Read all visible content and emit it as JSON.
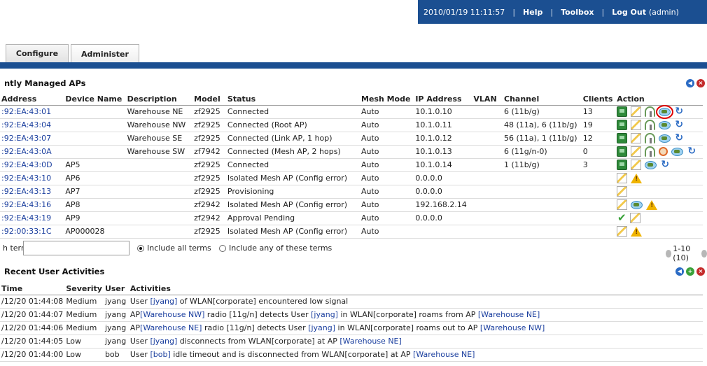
{
  "topbar": {
    "datetime": "2010/01/19  11:11:57",
    "help": "Help",
    "toolbox": "Toolbox",
    "logout": "Log Out",
    "user": "(admin)"
  },
  "tabs": {
    "configure": "Configure",
    "administer": "Administer"
  },
  "ap_panel": {
    "title": "ntly Managed APs",
    "columns": [
      "Address",
      "Device Name",
      "Description",
      "Model",
      "Status",
      "Mesh Mode",
      "IP Address",
      "VLAN",
      "Channel",
      "Clients",
      "Action"
    ],
    "rows": [
      {
        "mac": ":92:EA:43:01",
        "name": "",
        "desc": "Warehouse NE",
        "model": "zf2925",
        "status": "Connected",
        "mesh": "Auto",
        "ip": "10.1.0.10",
        "vlan": "",
        "channel": "6 (11b/g)",
        "clients": "13",
        "actions": [
          "monitor-icon",
          "edit-icon",
          "antenna-icon",
          "speedflex-icon",
          "restart-icon"
        ]
      },
      {
        "mac": ":92:EA:43:04",
        "name": "",
        "desc": "Warehouse NW",
        "model": "zf2925",
        "status": "Connected (Root AP)",
        "mesh": "Auto",
        "ip": "10.1.0.11",
        "vlan": "",
        "channel": "48 (11a), 6 (11b/g)",
        "clients": "19",
        "actions": [
          "monitor-icon",
          "edit-icon",
          "antenna-icon",
          "speedflex-icon",
          "restart-icon"
        ]
      },
      {
        "mac": ":92:EA:43:07",
        "name": "",
        "desc": "Warehouse SE",
        "model": "zf2925",
        "status": "Connected (Link AP, 1 hop)",
        "mesh": "Auto",
        "ip": "10.1.0.12",
        "vlan": "",
        "channel": "56 (11a), 1 (11b/g)",
        "clients": "12",
        "actions": [
          "monitor-icon",
          "edit-icon",
          "antenna-icon",
          "speedflex-icon",
          "restart-icon"
        ]
      },
      {
        "mac": ":92:EA:43:0A",
        "name": "",
        "desc": "Warehouse SW",
        "model": "zf7942",
        "status": "Connected (Mesh AP, 2 hops)",
        "mesh": "Auto",
        "ip": "10.1.0.13",
        "vlan": "",
        "channel": "6 (11g/n-0)",
        "clients": "0",
        "actions": [
          "monitor-icon",
          "edit-icon",
          "antenna-icon",
          "block-icon",
          "speedflex-icon",
          "restart-icon"
        ]
      },
      {
        "mac": ":92:EA:43:0D",
        "name": "AP5",
        "desc": "",
        "model": "zf2925",
        "status": "Connected",
        "mesh": "Auto",
        "ip": "10.1.0.14",
        "vlan": "",
        "channel": "1 (11b/g)",
        "clients": "3",
        "actions": [
          "monitor-icon",
          "edit-icon",
          "speedflex-icon",
          "restart-icon"
        ]
      },
      {
        "mac": ":92:EA:43:10",
        "name": "AP6",
        "desc": "",
        "model": "zf2925",
        "status": "Isolated Mesh AP (Config error)",
        "mesh": "Auto",
        "ip": "0.0.0.0",
        "vlan": "",
        "channel": "",
        "clients": "",
        "actions": [
          "edit-icon",
          "warning-icon"
        ]
      },
      {
        "mac": ":92:EA:43:13",
        "name": "AP7",
        "desc": "",
        "model": "zf2925",
        "status": "Provisioning",
        "mesh": "Auto",
        "ip": "0.0.0.0",
        "vlan": "",
        "channel": "",
        "clients": "",
        "actions": [
          "edit-icon"
        ]
      },
      {
        "mac": ":92:EA:43:16",
        "name": "AP8",
        "desc": "",
        "model": "zf2942",
        "status": "Isolated Mesh AP (Config error)",
        "mesh": "Auto",
        "ip": "192.168.2.14",
        "vlan": "",
        "channel": "",
        "clients": "",
        "actions": [
          "edit-icon",
          "speedflex-icon",
          "warning-icon"
        ]
      },
      {
        "mac": ":92:EA:43:19",
        "name": "AP9",
        "desc": "",
        "model": "zf2942",
        "status": "Approval Pending",
        "mesh": "Auto",
        "ip": "0.0.0.0",
        "vlan": "",
        "channel": "",
        "clients": "",
        "actions": [
          "approve-icon",
          "edit-icon"
        ]
      },
      {
        "mac": ":92:00:33:1C",
        "name": "AP000028",
        "desc": "",
        "model": "zf2925",
        "status": "Isolated Mesh AP (Config error)",
        "mesh": "Auto",
        "ip": "",
        "vlan": "",
        "channel": "",
        "clients": "",
        "actions": [
          "edit-icon",
          "warning-icon"
        ]
      }
    ],
    "search_label": "h terms",
    "search_value": "",
    "radio_all": "Include all terms",
    "radio_any": "Include any of these terms",
    "pager": "1-10 (10)"
  },
  "activity_panel": {
    "title": "Recent User Activities",
    "columns": [
      "Time",
      "Severity",
      "User",
      "Activities"
    ],
    "rows": [
      {
        "time": "/12/20 01:44:08",
        "severity": "Medium",
        "user": "jyang",
        "parts": [
          {
            "t": "User "
          },
          {
            "l": "[jyang]"
          },
          {
            "t": " of WLAN[corporate] encountered low signal"
          }
        ]
      },
      {
        "time": "/12/20 01:44:07",
        "severity": "Medium",
        "user": "jyang",
        "parts": [
          {
            "t": "AP"
          },
          {
            "l": "[Warehouse NW]"
          },
          {
            "t": " radio [11g/n] detects User "
          },
          {
            "l": "[jyang]"
          },
          {
            "t": " in WLAN[corporate] roams from AP "
          },
          {
            "l": "[Warehouse NE]"
          }
        ]
      },
      {
        "time": "/12/20 01:44:06",
        "severity": "Medium",
        "user": "jyang",
        "parts": [
          {
            "t": "AP"
          },
          {
            "l": "[Warehouse NE]"
          },
          {
            "t": " radio [11g/n] detects User "
          },
          {
            "l": "[jyang]"
          },
          {
            "t": " in WLAN[corporate] roams out to AP "
          },
          {
            "l": "[Warehouse NW]"
          }
        ]
      },
      {
        "time": "/12/20 01:44:05",
        "severity": "Low",
        "user": "jyang",
        "parts": [
          {
            "t": "User "
          },
          {
            "l": "[jyang]"
          },
          {
            "t": " disconnects from WLAN[corporate] at AP "
          },
          {
            "l": "[Warehouse NE]"
          }
        ]
      },
      {
        "time": "/12/20 01:44:00",
        "severity": "Low",
        "user": "bob",
        "parts": [
          {
            "t": "User "
          },
          {
            "l": "[bob]"
          },
          {
            "t": " idle timeout and is disconnected from WLAN[corporate] at AP "
          },
          {
            "l": "[Warehouse NE]"
          }
        ]
      }
    ]
  },
  "colors": {
    "brand_blue": "#1b4f91",
    "link": "#1a3e9e",
    "highlight": "#e00000"
  }
}
